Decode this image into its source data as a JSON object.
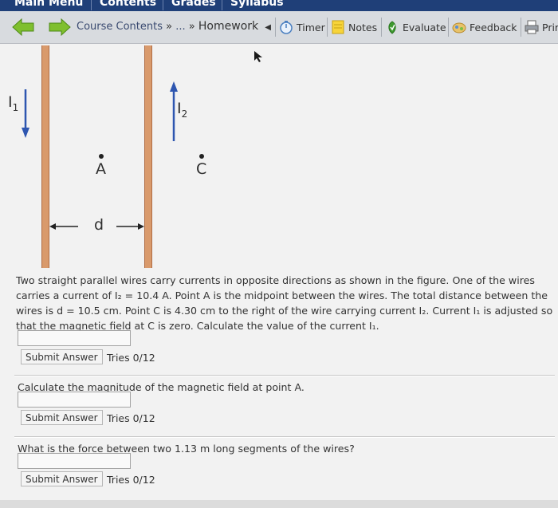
{
  "top_menu": {
    "items": [
      "Main Menu",
      "Contents",
      "Grades",
      "Syllabus"
    ]
  },
  "nav": {
    "back_icon": "left-arrow-icon",
    "forward_icon": "right-arrow-icon",
    "breadcrumb_course": "Course Contents",
    "breadcrumb_sep1": "»",
    "breadcrumb_ellipsis": "...",
    "breadcrumb_sep2": "»",
    "breadcrumb_current": "Homework",
    "tools": {
      "timer": "Timer",
      "notes": "Notes",
      "evaluate": "Evaluate",
      "feedback": "Feedback",
      "print": "Prir"
    }
  },
  "figure": {
    "current1_label": "I",
    "current1_sub": "1",
    "current2_label": "I",
    "current2_sub": "2",
    "point_a": "A",
    "point_c": "C",
    "distance_label": "d"
  },
  "question1": {
    "text": "Two straight parallel wires carry currents in opposite directions as shown in the figure. One of the wires carries a current of I₂ = 10.4 A. Point A is the midpoint between the wires. The total distance between the wires is d = 10.5 cm. Point C is 4.30 cm to the right of the wire carrying current I₂. Current I₁ is adjusted so that the magnetic field at C is zero. Calculate the value of the current I₁.",
    "answer_value": "",
    "submit_label": "Submit Answer",
    "tries": "Tries 0/12"
  },
  "question2": {
    "text": "Calculate the magnitude of the magnetic field at point A.",
    "answer_value": "",
    "submit_label": "Submit Answer",
    "tries": "Tries 0/12"
  },
  "question3": {
    "text": "What is the force between two 1.13 m long segments of the wires?",
    "answer_value": "",
    "submit_label": "Submit Answer",
    "tries": "Tries 0/12"
  }
}
